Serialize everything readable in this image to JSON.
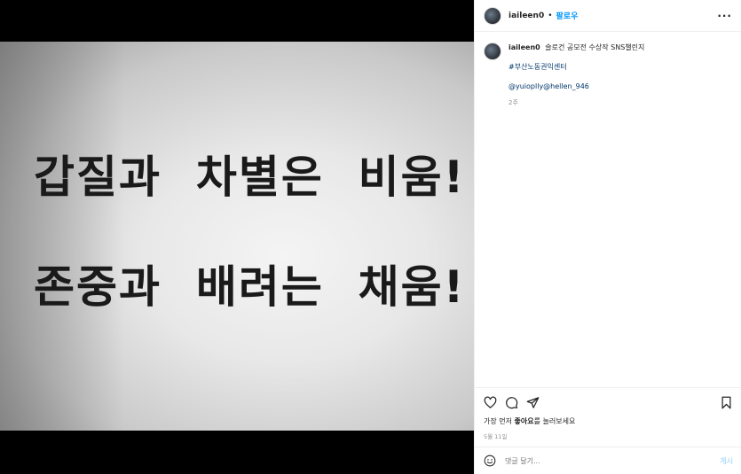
{
  "photo": {
    "line1": "갑질과  차별은  비움!",
    "line2": "존중과  배려는  채움!"
  },
  "header": {
    "username": "iaileen0",
    "separator": "•",
    "follow_label": "팔로우",
    "more_label": "···"
  },
  "caption": {
    "username": "iaileen0",
    "text": "슬로건 공모전 수상작 SNS챌린지",
    "hashtag": "#부산노동권익센터",
    "mentions": "@yuioplly@hellen_946",
    "time_ago": "2주"
  },
  "actions": {
    "likes_prefix": "가장 먼저 ",
    "likes_bold": "좋아요",
    "likes_suffix": "를 눌러보세요",
    "date": "5월 11일"
  },
  "comment": {
    "placeholder": "댓글 달기...",
    "post_label": "게시"
  },
  "icons": {
    "like": "heart-icon",
    "comment": "comment-icon",
    "share": "paper-plane-icon",
    "save": "bookmark-icon",
    "emoji": "smiley-icon",
    "tag": "user-tag-icon"
  },
  "colors": {
    "link": "#0095f6",
    "hashtag": "#00376b",
    "muted": "#8e8e8e",
    "post_disabled": "#b2dffc"
  }
}
